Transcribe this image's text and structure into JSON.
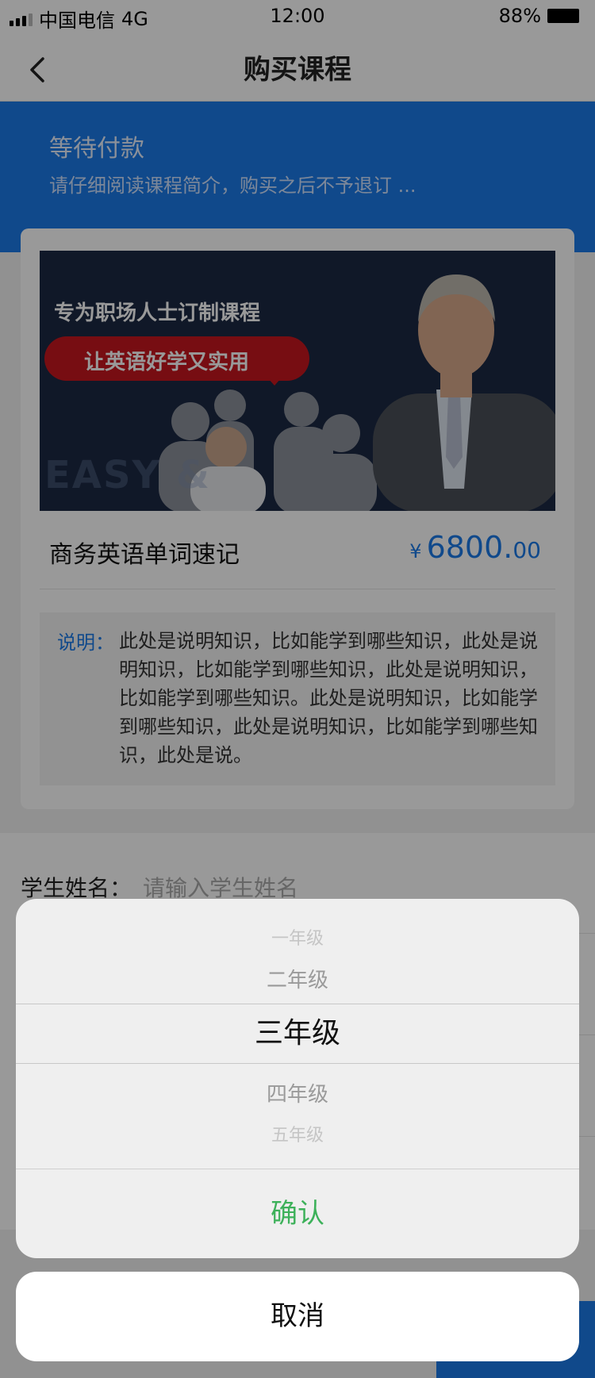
{
  "status_bar": {
    "carrier": "中国电信",
    "network": "4G",
    "time": "12:00",
    "battery": "88%"
  },
  "nav": {
    "title": "购买课程",
    "back_icon": "chevron-left-icon"
  },
  "banner": {
    "status": "等待付款",
    "notice": "请仔细阅读课程简介，购买之后不予退订 ..."
  },
  "course": {
    "image": {
      "slogan_line1": "专为职场人士订制课程",
      "slogan_line2": "让英语好学又实用",
      "watermark": "EASY &"
    },
    "name": "商务英语单词速记",
    "price": {
      "currency": "¥",
      "integer": "6800.",
      "decimal": "00"
    },
    "description_label": "说明：",
    "description": "此处是说明知识，比如能学到哪些知识，此处是说明知识，比如能学到哪些知识，此处是说明知识，比如能学到哪些知识。此处是说明知识，比如能学到哪些知识，此处是说明知识，比如能学到哪些知识，此处是说。"
  },
  "form": {
    "student_name_label": "学生姓名：",
    "student_name_placeholder": "请输入学生姓名"
  },
  "picker": {
    "options": [
      "一年级",
      "二年级",
      "三年级",
      "四年级",
      "五年级"
    ],
    "selected_index": 2,
    "confirm_label": "确认",
    "cancel_label": "取消"
  },
  "colors": {
    "primary": "#1c7be8",
    "confirm": "#3db15a",
    "overlay": "rgba(0,0,0,0.4)"
  }
}
